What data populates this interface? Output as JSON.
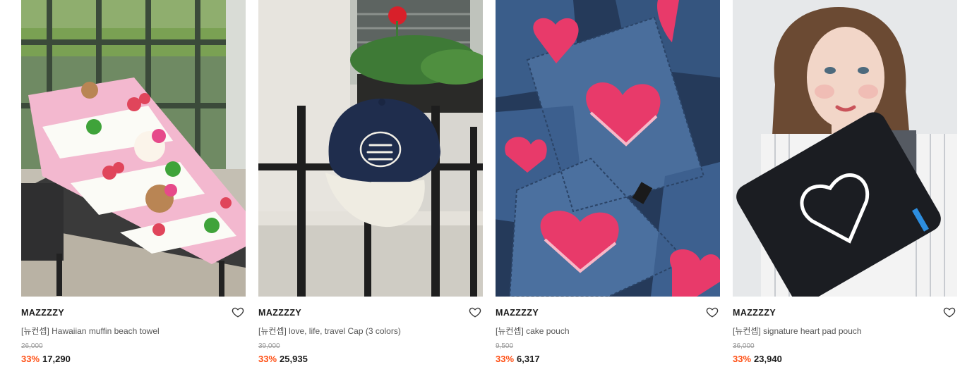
{
  "colors": {
    "discount": "#ff4f14",
    "brand_text": "#1a1a1a",
    "muted_text": "#999999"
  },
  "products": [
    {
      "image_desc": "pink-white striped beach towel with bear muffins on lounge chair",
      "brand": "MAZZZZY",
      "name": "[뉴컨셉] Hawaiian muffin beach towel",
      "original_price": "26,000",
      "discount": "33%",
      "price": "17,290",
      "icon": "heart-outline-icon"
    },
    {
      "image_desc": "navy and cream baseball cap hanging on black iron fence",
      "brand": "MAZZZZY",
      "name": "[뉴컨셉] love, life, travel Cap (3 colors)",
      "original_price": "39,000",
      "discount": "33%",
      "price": "25,935",
      "icon": "heart-outline-icon"
    },
    {
      "image_desc": "denim pouches with pink embroidered heart",
      "brand": "MAZZZZY",
      "name": "[뉴컨셉] cake pouch",
      "original_price": "9,500",
      "discount": "33%",
      "price": "6,317",
      "icon": "heart-outline-icon"
    },
    {
      "image_desc": "model holding black pad pouch with white heart outline",
      "brand": "MAZZZZY",
      "name": "[뉴컨셉] signature heart pad pouch",
      "original_price": "36,000",
      "discount": "33%",
      "price": "23,940",
      "icon": "heart-outline-icon"
    }
  ]
}
